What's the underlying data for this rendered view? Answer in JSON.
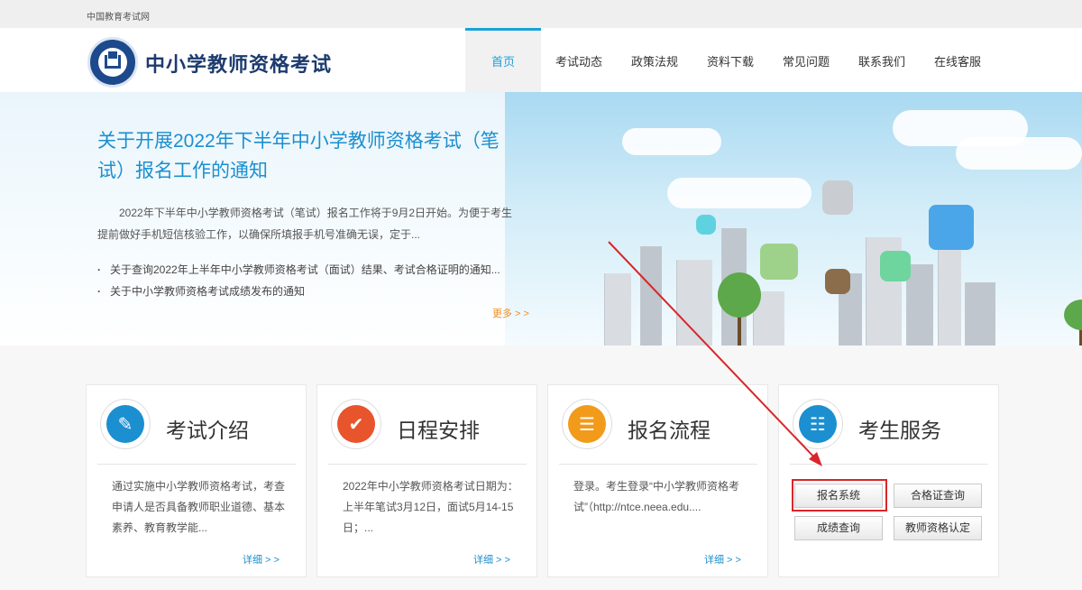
{
  "topbar": {
    "site_name": "中国教育考试网"
  },
  "header": {
    "title": "中小学教师资格考试",
    "nav": [
      {
        "label": "首页",
        "active": true
      },
      {
        "label": "考试动态"
      },
      {
        "label": "政策法规"
      },
      {
        "label": "资料下载"
      },
      {
        "label": "常见问题"
      },
      {
        "label": "联系我们"
      },
      {
        "label": "在线客服"
      }
    ]
  },
  "banner": {
    "headline": "关于开展2022年下半年中小学教师资格考试（笔试）报名工作的通知",
    "summary": "2022年下半年中小学教师资格考试（笔试）报名工作将于9月2日开始。为便于考生提前做好手机短信核验工作，以确保所填报手机号准确无误，定于...",
    "links": [
      "关于查询2022年上半年中小学教师资格考试（面试）结果、考试合格证明的通知...",
      "关于中小学教师资格考试成绩发布的通知"
    ],
    "more": "更多 > >"
  },
  "cards": [
    {
      "title": "考试介绍",
      "text": "通过实施中小学教师资格考试，考查申请人是否具备教师职业道德、基本素养、教育教学能...",
      "detail": "详细 > >",
      "color": "#1b8fd0"
    },
    {
      "title": "日程安排",
      "text": "2022年中小学教师资格考试日期为：上半年笔试3月12日，面试5月14-15日；...",
      "detail": "详细 > >",
      "color": "#e8542b"
    },
    {
      "title": "报名流程",
      "text": "登录。考生登录“中小学教师资格考试”（http://ntce.neea.edu....",
      "detail": "详细 > >",
      "color": "#f29a1a"
    },
    {
      "title": "考生服务",
      "color": "#1b8fd0",
      "buttons": [
        "报名系统",
        "合格证查询",
        "成绩查询",
        "教师资格认定"
      ]
    }
  ],
  "colors": {
    "accent": "#1aa2d9",
    "highlight": "#d8262a",
    "brand": "#1d3b6e"
  }
}
